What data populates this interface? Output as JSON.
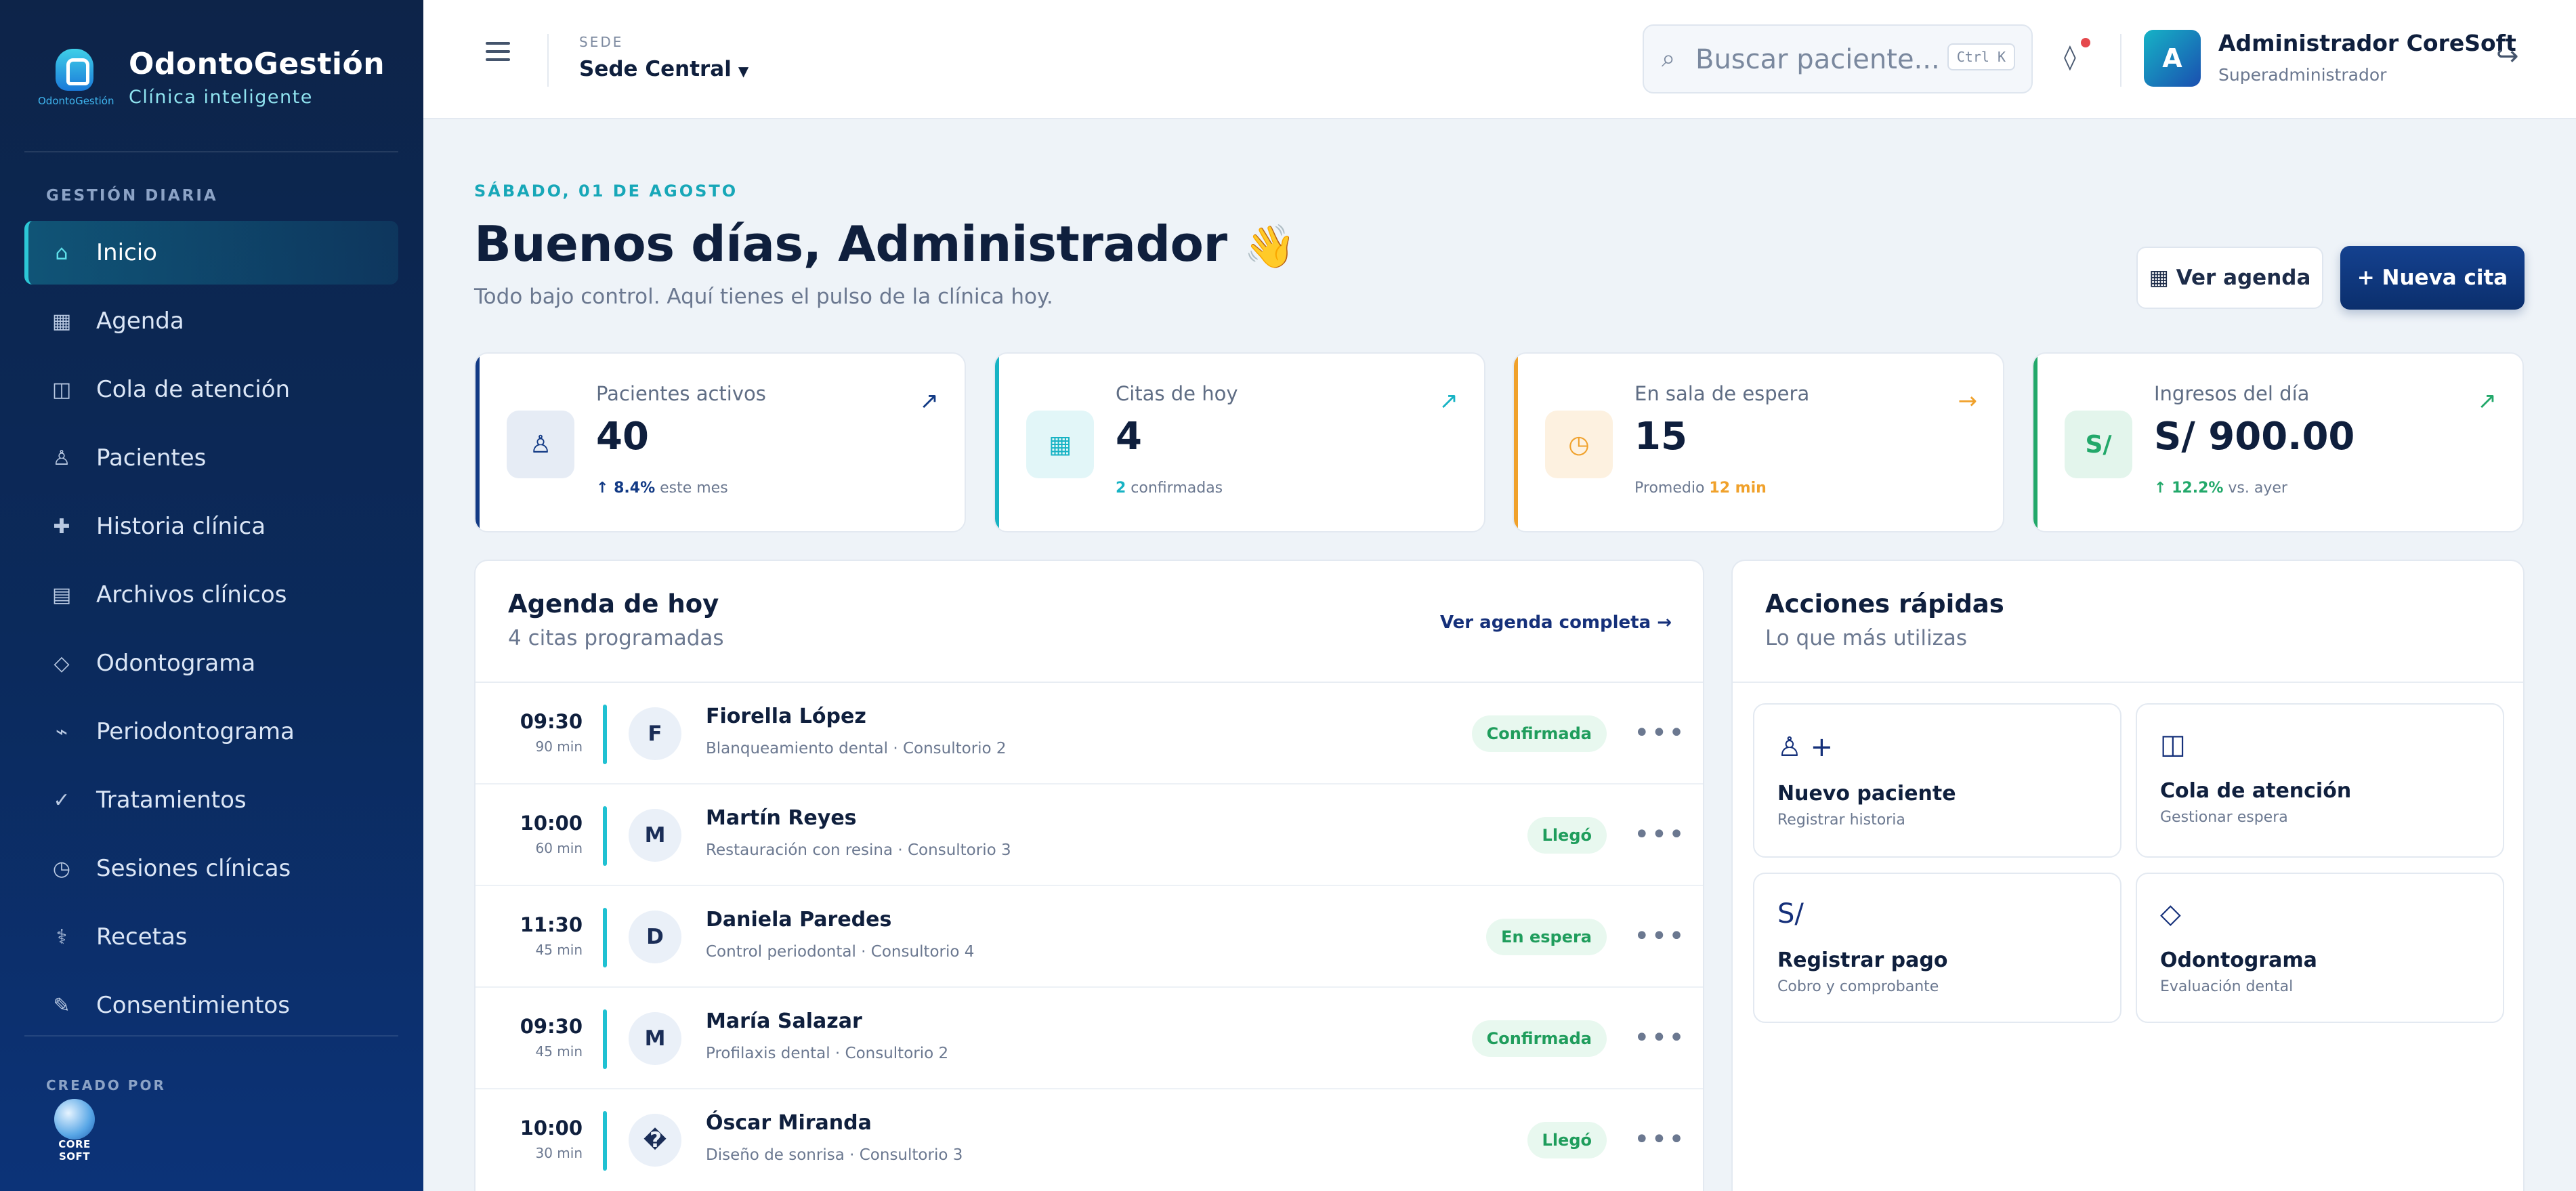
{
  "brand": {
    "name": "OdontoGestión",
    "tagline": "Clínica inteligente",
    "logo_text": "OdontoGestión"
  },
  "sidebar": {
    "section_label": "GESTIÓN DIARIA",
    "items": [
      {
        "label": "Inicio",
        "icon": "home-icon",
        "glyph": "⌂",
        "active": true
      },
      {
        "label": "Agenda",
        "icon": "calendar-icon",
        "glyph": "▦"
      },
      {
        "label": "Cola de atención",
        "icon": "queue-icon",
        "glyph": "◫"
      },
      {
        "label": "Pacientes",
        "icon": "patient-icon",
        "glyph": "♙"
      },
      {
        "label": "Historia clínica",
        "icon": "plus-icon",
        "glyph": "✚"
      },
      {
        "label": "Archivos clínicos",
        "icon": "files-icon",
        "glyph": "▤"
      },
      {
        "label": "Odontograma",
        "icon": "diamond-icon",
        "glyph": "◇"
      },
      {
        "label": "Periodontograma",
        "icon": "wave-icon",
        "glyph": "⌁"
      },
      {
        "label": "Tratamientos",
        "icon": "check-icon",
        "glyph": "✓"
      },
      {
        "label": "Sesiones clínicas",
        "icon": "clock-icon",
        "glyph": "◷"
      },
      {
        "label": "Recetas",
        "icon": "rx-icon",
        "glyph": "⚕"
      },
      {
        "label": "Consentimientos",
        "icon": "pen-icon",
        "glyph": "✎"
      }
    ],
    "created_by_label": "CREADO POR",
    "created_by_logo": "CORE SOFT"
  },
  "topbar": {
    "sede_label": "SEDE",
    "sede_value": "Sede Central",
    "search_placeholder": "Buscar paciente...",
    "search_shortcut": "Ctrl K",
    "user_initial": "A",
    "user_name": "Administrador CoreSoft",
    "user_role": "Superadministrador"
  },
  "main": {
    "date": "SÁBADO, 01 DE AGOSTO",
    "greeting": "Buenos días, Administrador",
    "greeting_emoji": "👋",
    "subtitle": "Todo bajo control. Aquí tienes el pulso de la clínica hoy.",
    "btn_agenda": "▦ Ver agenda",
    "btn_new": "+ Nueva cita"
  },
  "stats": [
    {
      "label": "Pacientes activos",
      "value": "40",
      "foot_strong": "↑ 8.4%",
      "foot_text": " este mes",
      "icon": "patient-icon",
      "glyph": "♙",
      "arrow": "↗",
      "accent": "#123a85",
      "icon_bg": "#e6ecf5",
      "icon_color": "#123a85",
      "foot_color": "#123a85",
      "arrow_color": "#123a85"
    },
    {
      "label": "Citas de hoy",
      "value": "4",
      "foot_strong": "2",
      "foot_text": " confirmadas",
      "icon": "calendar-icon",
      "glyph": "▦",
      "arrow": "↗",
      "accent": "#17b3c4",
      "icon_bg": "#e2f6f8",
      "icon_color": "#17b3c4",
      "foot_color": "#17b3c4",
      "arrow_color": "#17b3c4"
    },
    {
      "label": "En sala de espera",
      "value": "15",
      "foot_strong": "12 min",
      "foot_text": "Promedio ",
      "icon": "clock-icon",
      "glyph": "◷",
      "arrow": "→",
      "accent": "#f0a12b",
      "icon_bg": "#fdf1e0",
      "icon_color": "#f0a12b",
      "foot_color": "#f0a12b",
      "arrow_color": "#f0a12b",
      "strong_after": true
    },
    {
      "label": "Ingresos del día",
      "value": "S/ 900.00",
      "foot_strong": "↑ 12.2%",
      "foot_text": " vs. ayer",
      "icon": "currency-icon",
      "glyph": "S/",
      "arrow": "↗",
      "accent": "#22a86a",
      "icon_bg": "#e3f5ec",
      "icon_color": "#22a86a",
      "foot_color": "#22a86a",
      "arrow_color": "#22a86a"
    }
  ],
  "agenda": {
    "title": "Agenda de hoy",
    "subtitle": "4 citas programadas",
    "link": "Ver agenda completa →",
    "appointments": [
      {
        "time": "09:30",
        "duration": "90 min",
        "initial": "F",
        "name": "Fiorella López",
        "desc": "Blanqueamiento dental · Consultorio 2",
        "status": "Confirmada"
      },
      {
        "time": "10:00",
        "duration": "60 min",
        "initial": "M",
        "name": "Martín Reyes",
        "desc": "Restauración con resina · Consultorio 3",
        "status": "Llegó"
      },
      {
        "time": "11:30",
        "duration": "45 min",
        "initial": "D",
        "name": "Daniela Paredes",
        "desc": "Control periodontal · Consultorio 4",
        "status": "En espera"
      },
      {
        "time": "09:30",
        "duration": "45 min",
        "initial": "M",
        "name": "María Salazar",
        "desc": "Profilaxis dental · Consultorio 2",
        "status": "Confirmada"
      },
      {
        "time": "10:00",
        "duration": "30 min",
        "initial": "�",
        "name": "Óscar Miranda",
        "desc": "Diseño de sonrisa · Consultorio 3",
        "status": "Llegó"
      }
    ],
    "more_glyph": "•••"
  },
  "quick": {
    "title": "Acciones rápidas",
    "subtitle": "Lo que más utilizas",
    "actions": [
      {
        "title": "Nuevo paciente",
        "sub": "Registrar historia",
        "icon": "add-patient-icon",
        "glyph": "♙ +"
      },
      {
        "title": "Cola de atención",
        "sub": "Gestionar espera",
        "icon": "queue-icon",
        "glyph": "◫"
      },
      {
        "title": "Registrar pago",
        "sub": "Cobro y comprobante",
        "icon": "currency-icon",
        "glyph": "S/"
      },
      {
        "title": "Odontograma",
        "sub": "Evaluación dental",
        "icon": "diamond-icon",
        "glyph": "◇"
      }
    ]
  }
}
